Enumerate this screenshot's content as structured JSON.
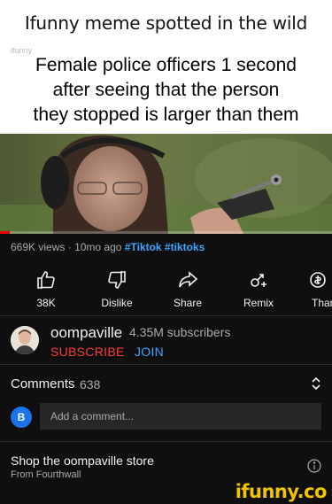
{
  "meme": {
    "header_text": "Ifunny meme spotted in the wild"
  },
  "video": {
    "caption_lines": [
      "Female police officers 1 second",
      "after seeing that the person",
      "they stopped is larger than them"
    ],
    "watermark": "ifunny",
    "progress_fraction": 0.03
  },
  "meta": {
    "views": "669K views",
    "age": "10mo ago",
    "tags": [
      "#Tiktok",
      "#tiktoks"
    ]
  },
  "actions": {
    "like_count": "38K",
    "dislike_label": "Dislike",
    "share_label": "Share",
    "remix_label": "Remix",
    "thanks_label": "Thar"
  },
  "channel": {
    "name": "oompaville",
    "subscribers": "4.35M subscribers",
    "subscribe_label": "SUBSCRIBE",
    "join_label": "JOIN"
  },
  "comments": {
    "title": "Comments",
    "count": "638",
    "user_initial": "B",
    "placeholder": "Add a comment..."
  },
  "store": {
    "title": "Shop the oompaville store",
    "subtitle": "From Fourthwall"
  },
  "footer": {
    "logo": "ifunny.co"
  },
  "colors": {
    "accent_red": "#ff3b3b",
    "link_blue": "#3ea6ff",
    "background": "#0f0f0f",
    "logo_yellow": "#f2c400"
  }
}
